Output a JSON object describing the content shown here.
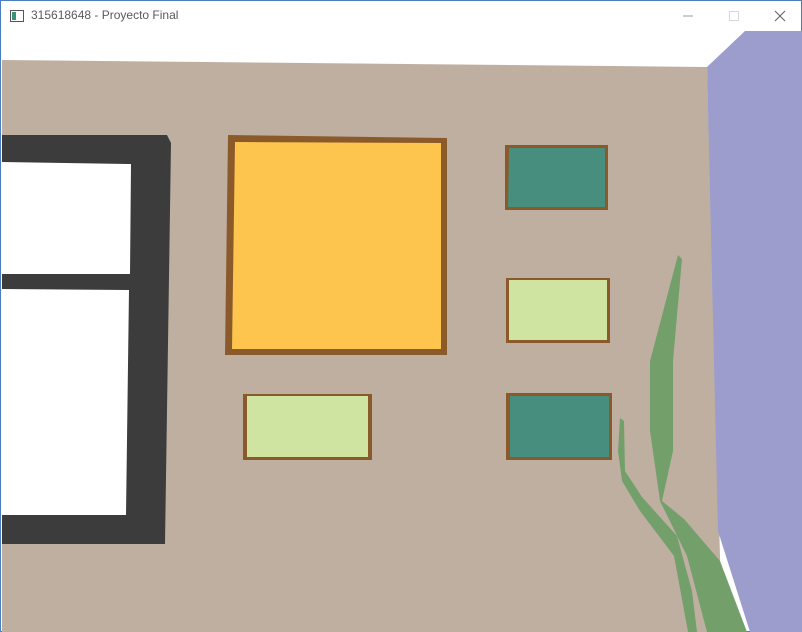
{
  "window": {
    "title": "315618648 - Proyecto Final",
    "controls": [
      "minimize",
      "maximize",
      "close"
    ]
  },
  "icons": {
    "app": "app-window-icon",
    "minimize": "minimize-icon",
    "maximize": "maximize-icon",
    "close": "close-icon"
  },
  "colors": {
    "wall": "#bfafa1",
    "side_wall": "#9c9ccd",
    "ceiling": "#ffffff",
    "window_frame": "#3c3c3c",
    "window_pane": "#ffffff",
    "frame_border": "#8b5a2b",
    "orange_painting": "#fdc44e",
    "teal_painting": "#478e7e",
    "lime_painting": "#cfe4a0",
    "plant": "#73a06a",
    "window_border": "#4a7fbf"
  }
}
